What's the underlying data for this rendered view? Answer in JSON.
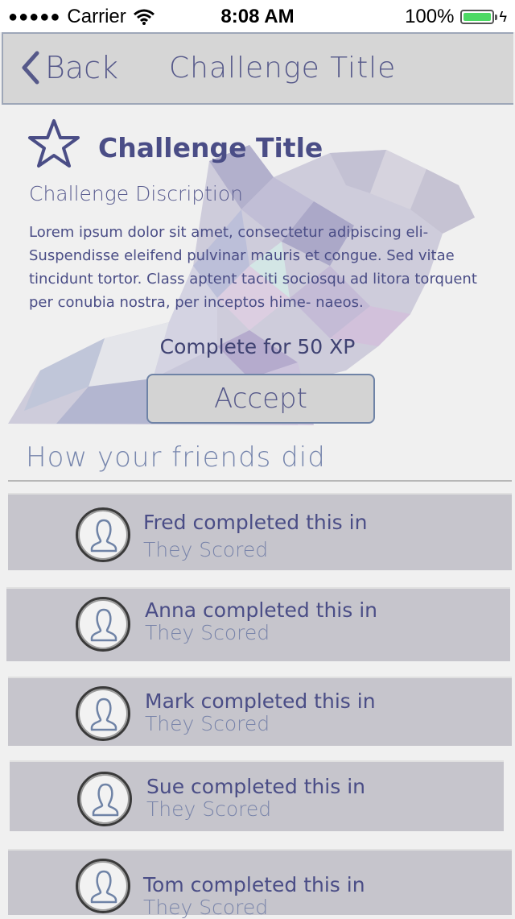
{
  "status_bar": {
    "carrier": "Carrier",
    "time": "8:08 AM",
    "battery": "100%",
    "signal_dots": "●●●●●"
  },
  "nav": {
    "back_label": "Back",
    "title": "Challenge Title"
  },
  "challenge": {
    "title": "Challenge Title",
    "description_label": "Challenge Discription",
    "body": "Lorem ipsum dolor sit amet, consectetur adipiscing eli- Suspendisse eleifend pulvinar mauris et congue. Sed vitae tincidunt tortor. Class aptent taciti sociosqu ad litora torquent per conubia nostra, per inceptos hime- naeos.",
    "xp_text": "Complete for 50 XP",
    "accept_label": "Accept"
  },
  "friends": {
    "heading": "How your friends did",
    "items": [
      {
        "name_line": "Fred completed this in",
        "score_line": "They Scored"
      },
      {
        "name_line": "Anna completed this in",
        "score_line": "They Scored"
      },
      {
        "name_line": "Mark completed this in",
        "score_line": "They Scored"
      },
      {
        "name_line": "Sue completed this in",
        "score_line": "They Scored"
      },
      {
        "name_line": "Tom completed this in",
        "score_line": "They Scored"
      }
    ]
  },
  "icons": {
    "back": "chevron-left-icon",
    "star": "star-outline-icon",
    "avatar": "user-silhouette-icon",
    "wifi": "wifi-icon",
    "battery": "battery-icon"
  },
  "colors": {
    "accent": "#4a4d86",
    "nav_bg": "#d6d6d6",
    "row_bg": "#c6c5cc",
    "battery": "#4cd964"
  }
}
